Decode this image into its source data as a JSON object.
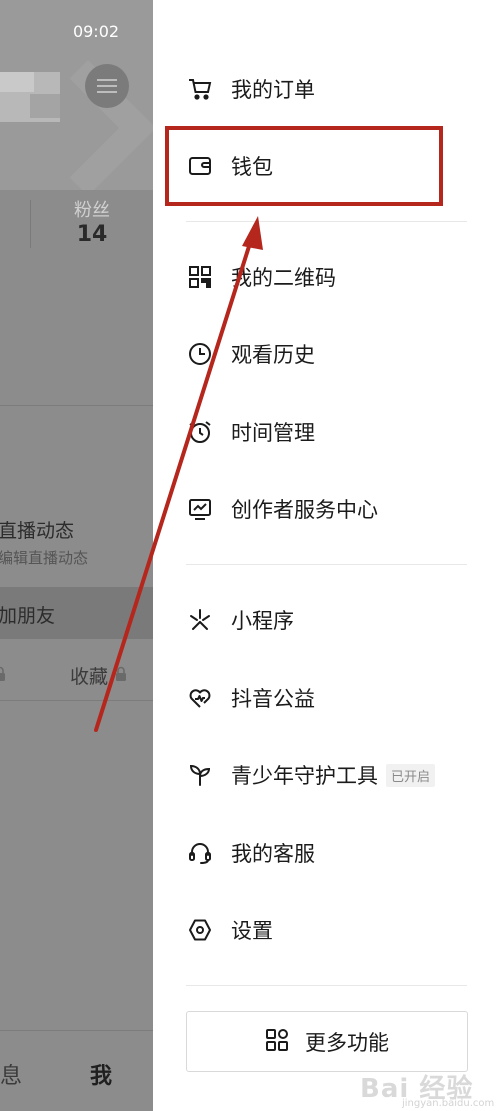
{
  "status_bar": {
    "time": "09:02"
  },
  "background_profile": {
    "fans_label": "粉丝",
    "fans_count": "14",
    "live_title": "直播动态",
    "live_subtitle": "编辑直播动态",
    "add_friend": "加朋友",
    "favorites_tab": "收藏",
    "bottom_nav": {
      "messages": "息",
      "me": "我"
    }
  },
  "drawer": {
    "items": [
      {
        "label": "我的订单",
        "icon": "cart-icon"
      },
      {
        "label": "钱包",
        "icon": "wallet-icon"
      },
      {
        "label": "我的二维码",
        "icon": "qr-code-icon"
      },
      {
        "label": "观看历史",
        "icon": "clock-icon"
      },
      {
        "label": "时间管理",
        "icon": "alarm-icon"
      },
      {
        "label": "创作者服务中心",
        "icon": "chart-monitor-icon"
      },
      {
        "label": "小程序",
        "icon": "mini-program-icon"
      },
      {
        "label": "抖音公益",
        "icon": "heart-icon"
      },
      {
        "label": "青少年守护工具",
        "icon": "sprout-icon",
        "badge": "已开启"
      },
      {
        "label": "我的客服",
        "icon": "headset-icon"
      },
      {
        "label": "设置",
        "icon": "settings-hexagon-icon"
      }
    ],
    "more_button": {
      "label": "更多功能",
      "icon": "grid-apps-icon"
    }
  },
  "annotation": {
    "highlight_color": "#b5261d"
  },
  "watermark": {
    "text": "Bai 经验",
    "sub": "jingyan.baidu.com"
  }
}
